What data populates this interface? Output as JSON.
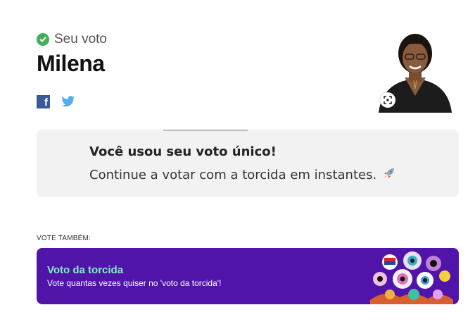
{
  "vote": {
    "status_label": "Seu voto",
    "candidate_name": "Milena",
    "status_color": "#3fb05a"
  },
  "share": {
    "facebook_icon": "facebook-icon",
    "facebook_glyph": "f",
    "twitter_icon": "twitter-icon"
  },
  "info_card": {
    "title": "Você usou seu voto único!",
    "subtitle": "Continue a votar com a torcida em instantes.",
    "emoji_icon": "rocket-icon"
  },
  "also_vote": {
    "label": "VOTE TAMBÉM:",
    "banner_title": "Voto da torcida",
    "banner_subtitle": "Vote quantas vezes quiser no 'voto da torcida'!",
    "banner_color": "#5014a8",
    "title_color": "#7ef2c6"
  }
}
